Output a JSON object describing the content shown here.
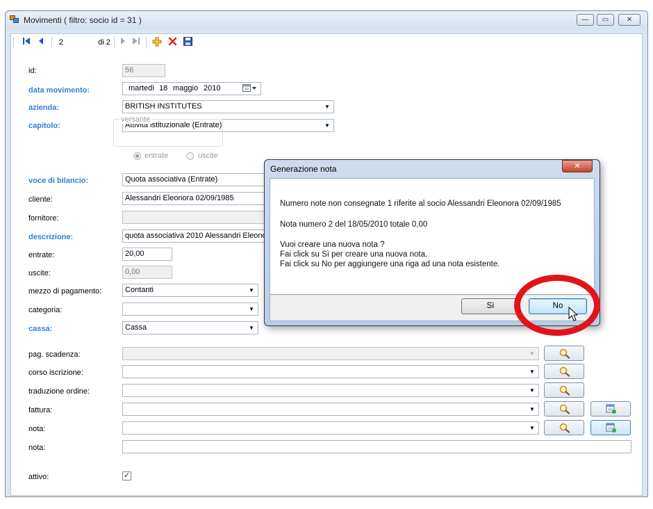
{
  "window": {
    "title": "Movimenti ( filtro: socio id = 31 )",
    "minimize": "—",
    "maximize": "▭",
    "close": "✕"
  },
  "toolbar": {
    "position": "2",
    "of_label": "di 2"
  },
  "form": {
    "id": {
      "label": "id:",
      "value": "56"
    },
    "data_movimento": {
      "label": "data movimento:",
      "weekday": "martedì",
      "day": "18",
      "month": "maggio",
      "year": "2010"
    },
    "azienda": {
      "label": "azienda:",
      "value": "BRITISH INSTITUTES"
    },
    "capitolo": {
      "label": "capitolo:",
      "value": "Attività istituzionale (Entrate)"
    },
    "versante": {
      "title": "versante",
      "options": [
        "entrate",
        "uscite"
      ],
      "selected": "entrate"
    },
    "voce_di_bilancio": {
      "label": "voce di bilancio:",
      "value": "Quota associativa (Entrate)"
    },
    "cliente": {
      "label": "cliente:",
      "value": "Alessandri Eleonora 02/09/1985"
    },
    "fornitore": {
      "label": "fornitore:",
      "value": ""
    },
    "descrizione": {
      "label": "descrizione:",
      "value": "quota associativa 2010 Alessandri Eleonora"
    },
    "entrate": {
      "label": "entrate:",
      "value": "20,00"
    },
    "uscite": {
      "label": "uscite:",
      "value": "0,00"
    },
    "mezzo_di_pagamento": {
      "label": "mezzo di pagamento:",
      "value": "Contanti"
    },
    "categoria": {
      "label": "categoria:",
      "value": ""
    },
    "cassa": {
      "label": "cassa:",
      "value": "Cassa"
    },
    "pag_scadenza": {
      "label": "pag. scadenza:",
      "value": ""
    },
    "corso_iscrizione": {
      "label": "corso iscrizione:",
      "value": ""
    },
    "traduzione_ordine": {
      "label": "traduzione ordine:",
      "value": ""
    },
    "fattura": {
      "label": "fattura:",
      "value": ""
    },
    "nota_combo": {
      "label": "nota:",
      "value": ""
    },
    "nota_text": {
      "label": "nota:",
      "value": ""
    },
    "attivo": {
      "label": "attivo:",
      "checked": true,
      "check_glyph": "✓"
    }
  },
  "dialog": {
    "title": "Generazione nota",
    "close": "✕",
    "line1": "Numero note non consegnate 1 riferite al socio Alessandri Eleonora 02/09/1985",
    "line2": "Nota numero 2 del 18/05/2010 totale 0,00",
    "line3": "Vuoi creare una nuova nota ?",
    "line4": "Fai click su Sì per creare una nuova nota.",
    "line5": "Fai click su No per aggiungere una riga ad una nota esistente.",
    "yes": "Sì",
    "no": "No"
  },
  "colors": {
    "required_label": "#2e7fd6",
    "highlight": "#e2141b",
    "window_frame": "#dbe6f3"
  },
  "icons": [
    "app-icon",
    "first-record-icon",
    "prev-record-icon",
    "next-record-icon",
    "last-record-icon",
    "add-icon",
    "delete-icon",
    "save-icon",
    "calendar-icon",
    "magnifier-icon",
    "add-record-icon",
    "mouse-cursor-icon"
  ]
}
